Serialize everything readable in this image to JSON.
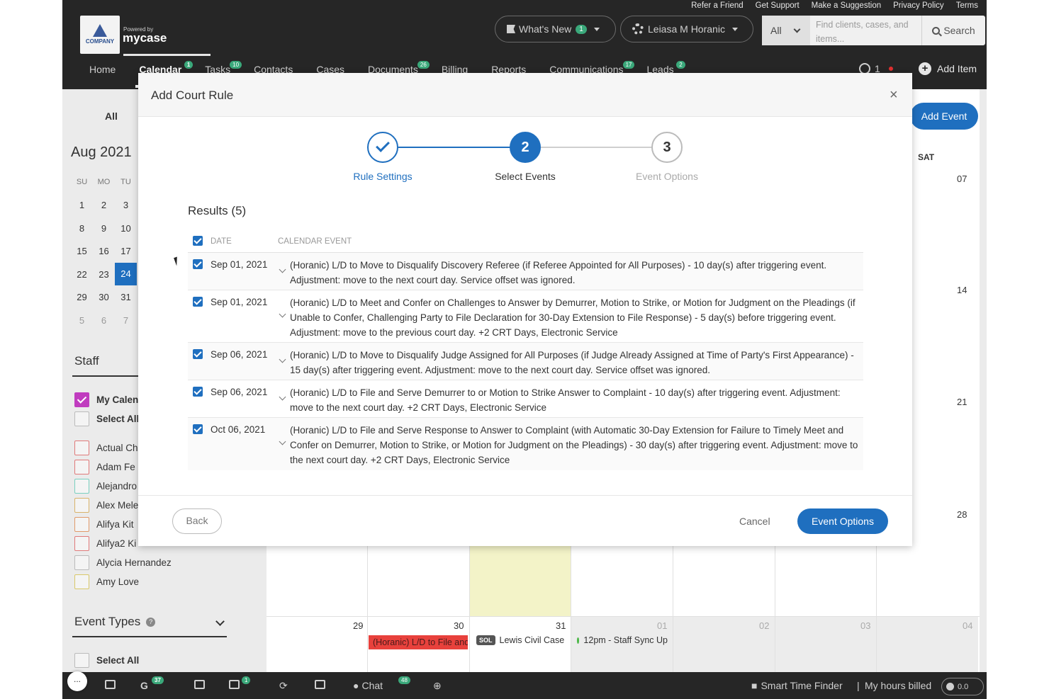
{
  "top_links": [
    "Refer a Friend",
    "Get Support",
    "Make a Suggestion",
    "Privacy Policy",
    "Terms"
  ],
  "logo": {
    "company": "COMPANY",
    "powered_by": "Powered by",
    "brand": "mycase"
  },
  "header": {
    "whats_new": "What's New",
    "whats_new_badge": "1",
    "user_name": "Leiasa M Horanic",
    "search_scope": "All",
    "search_placeholder": "Find clients, cases, and items...",
    "search_button": "Search"
  },
  "nav": {
    "items": [
      {
        "label": "Home",
        "badge": ""
      },
      {
        "label": "Calendar",
        "badge": "1"
      },
      {
        "label": "Tasks",
        "badge": "10"
      },
      {
        "label": "Contacts",
        "badge": ""
      },
      {
        "label": "Cases",
        "badge": ""
      },
      {
        "label": "Documents",
        "badge": "26"
      },
      {
        "label": "Billing",
        "badge": ""
      },
      {
        "label": "Reports",
        "badge": ""
      },
      {
        "label": "Communications",
        "badge": "17"
      },
      {
        "label": "Leads",
        "badge": "2"
      }
    ],
    "timer_count": "1",
    "add_item": "Add Item"
  },
  "sidebar": {
    "all_label": "All",
    "month": "Aug 2021",
    "weekdays": [
      "SU",
      "MO",
      "TU"
    ],
    "weeks": [
      [
        "1",
        "2",
        "3"
      ],
      [
        "8",
        "9",
        "10"
      ],
      [
        "15",
        "16",
        "17"
      ],
      [
        "22",
        "23",
        "24"
      ],
      [
        "29",
        "30",
        "31"
      ],
      [
        "5",
        "6",
        "7"
      ]
    ],
    "staff_title": "Staff",
    "staff": [
      {
        "label": "My Calendar",
        "color": "#c03cbf",
        "checked": true
      },
      {
        "label": "Select All",
        "color": "#bbbbbb",
        "checked": false
      },
      {
        "label": "Actual Ch",
        "color": "#e07a7a",
        "checked": false
      },
      {
        "label": "Adam Fe",
        "color": "#e07a7a",
        "checked": false
      },
      {
        "label": "Alejandro",
        "color": "#7ad0c0",
        "checked": false
      },
      {
        "label": "Alex Mele",
        "color": "#d9b36a",
        "checked": false
      },
      {
        "label": "Alifya Kit",
        "color": "#e09a6a",
        "checked": false
      },
      {
        "label": "Alifya2 Ki",
        "color": "#e07a7a",
        "checked": false
      },
      {
        "label": "Alycia Hernandez",
        "color": "#bbbbbb",
        "checked": false
      },
      {
        "label": "Amy Love",
        "color": "#d9c86a",
        "checked": false
      }
    ],
    "event_types_title": "Event Types",
    "event_types_select_all": "Select All"
  },
  "calendar": {
    "add_event": "Add Event",
    "sat_header": "SAT",
    "sat_days": [
      "07",
      "14",
      "21",
      "28"
    ],
    "bottom_row_days": [
      "29",
      "30",
      "31",
      "01",
      "02",
      "03",
      "04"
    ],
    "events": {
      "red": "(Horanic) L/D to File and Serve",
      "sol_tag": "SOL",
      "sol_text": "Lewis Civil Case",
      "staff_sync": "12pm - Staff Sync Up"
    }
  },
  "bottombar": {
    "more": "...",
    "g_badge": "37",
    "mail_badge": "1",
    "chat": "Chat",
    "chat_badge": "48",
    "smart_time_finder": "Smart Time Finder",
    "separator": "|",
    "my_hours": "My hours billed",
    "hours_value": "0.0"
  },
  "modal": {
    "title": "Add Court Rule",
    "close": "×",
    "steps": [
      {
        "number": "1",
        "label": "Rule Settings",
        "state": "done"
      },
      {
        "number": "2",
        "label": "Select Events",
        "state": "active"
      },
      {
        "number": "3",
        "label": "Event Options",
        "state": "todo"
      }
    ],
    "results_title": "Results (5)",
    "columns": [
      "DATE",
      "CALENDAR EVENT"
    ],
    "rows": [
      {
        "date": "Sep 01, 2021",
        "event": "(Horanic) L/D to Move to Disqualify Discovery Referee (if Referee Appointed for All Purposes) - 10 day(s) after triggering event. Adjustment: move to the next court day. Service offset was ignored."
      },
      {
        "date": "Sep 01, 2021",
        "event": "(Horanic) L/D to Meet and Confer on Challenges to Answer by Demurrer, Motion to Strike, or Motion for Judgment on the Pleadings (if Unable to Confer, Challenging Party to File Declaration for 30-Day Extension to File Response) - 5 day(s) before triggering event. Adjustment: move to the previous court day. +2 CRT Days, Electronic Service"
      },
      {
        "date": "Sep 06, 2021",
        "event": "(Horanic) L/D to Move to Disqualify Judge Assigned for All Purposes (if Judge Already Assigned at Time of Party's First Appearance) - 15 day(s) after triggering event. Adjustment: move to the next court day. Service offset was ignored."
      },
      {
        "date": "Sep 06, 2021",
        "event": "(Horanic) L/D to File and Serve Demurrer to or Motion to Strike Answer to Complaint - 10 day(s) after triggering event. Adjustment: move to the next court day. +2 CRT Days, Electronic Service"
      },
      {
        "date": "Oct 06, 2021",
        "event": "(Horanic) L/D to File and Serve Response to Answer to Complaint (with Automatic 30-Day Extension for Failure to Timely Meet and Confer on Demurrer, Motion to Strike, or Motion for Judgment on the Pleadings) - 30 day(s) after triggering event. Adjustment: move to the next court day. +2 CRT Days, Electronic Service"
      }
    ],
    "back": "Back",
    "cancel": "Cancel",
    "next": "Event Options"
  }
}
